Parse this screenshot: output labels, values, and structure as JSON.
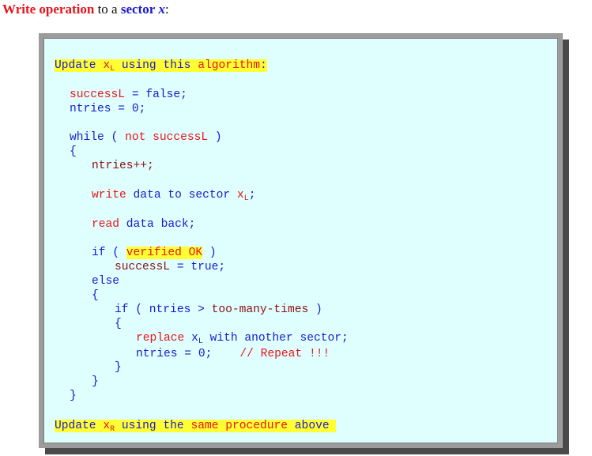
{
  "heading": {
    "part1": "Write operation",
    "part2": " to a ",
    "part3": "sector",
    "part4": " ",
    "part5": "x",
    "part6": ":"
  },
  "code": {
    "update_xl": {
      "kw1": "Update ",
      "var": "x",
      "sub": "L",
      "kw2": " using this ",
      "kw3": "algorithm",
      "tail": ":"
    },
    "success_init": {
      "var": "successL",
      "rest": " = false;"
    },
    "ntries_init": "ntries = 0;",
    "while_line": {
      "kw": "while ( ",
      "kw2": "not",
      "var": " successL",
      "close": " )"
    },
    "brace_open_1": "{",
    "ntries_inc": "ntries++;",
    "write_line": {
      "kw": "write",
      "rest": " data to sector ",
      "var": "x",
      "sub": "L",
      "tail": ";"
    },
    "read_line": {
      "kw": "read",
      "rest": " data back;"
    },
    "if_line": {
      "kw": "if ( ",
      "cond": "verified OK",
      "close": " )"
    },
    "success_true": {
      "var": "successL",
      "rest": " = true;"
    },
    "else_line": "else",
    "brace_open_2": "{",
    "if2_line": {
      "kw": "if ( ntries > ",
      "cond": "too-many-times",
      "close": " )"
    },
    "brace_open_3": "{",
    "replace_line": {
      "kw": "replace ",
      "var": "x",
      "sub": "L",
      "rest": " with another sector;"
    },
    "ntries_reset": {
      "code": "ntries = 0;",
      "spacer": "    ",
      "comment": "// Repeat !!!"
    },
    "brace_close_3": "}",
    "brace_close_2": "}",
    "brace_close_1": "}",
    "update_xr": {
      "kw1": "Update ",
      "var": "x",
      "sub": "R",
      "kw2": " using the ",
      "kw3": "same procedure",
      "kw4": " above",
      "tail": " "
    }
  },
  "colors": {
    "red": "#e8141b",
    "blue": "#1a1acc",
    "darkred": "#8b1010",
    "highlight": "#ffff33",
    "box_bg": "#dffefe"
  }
}
